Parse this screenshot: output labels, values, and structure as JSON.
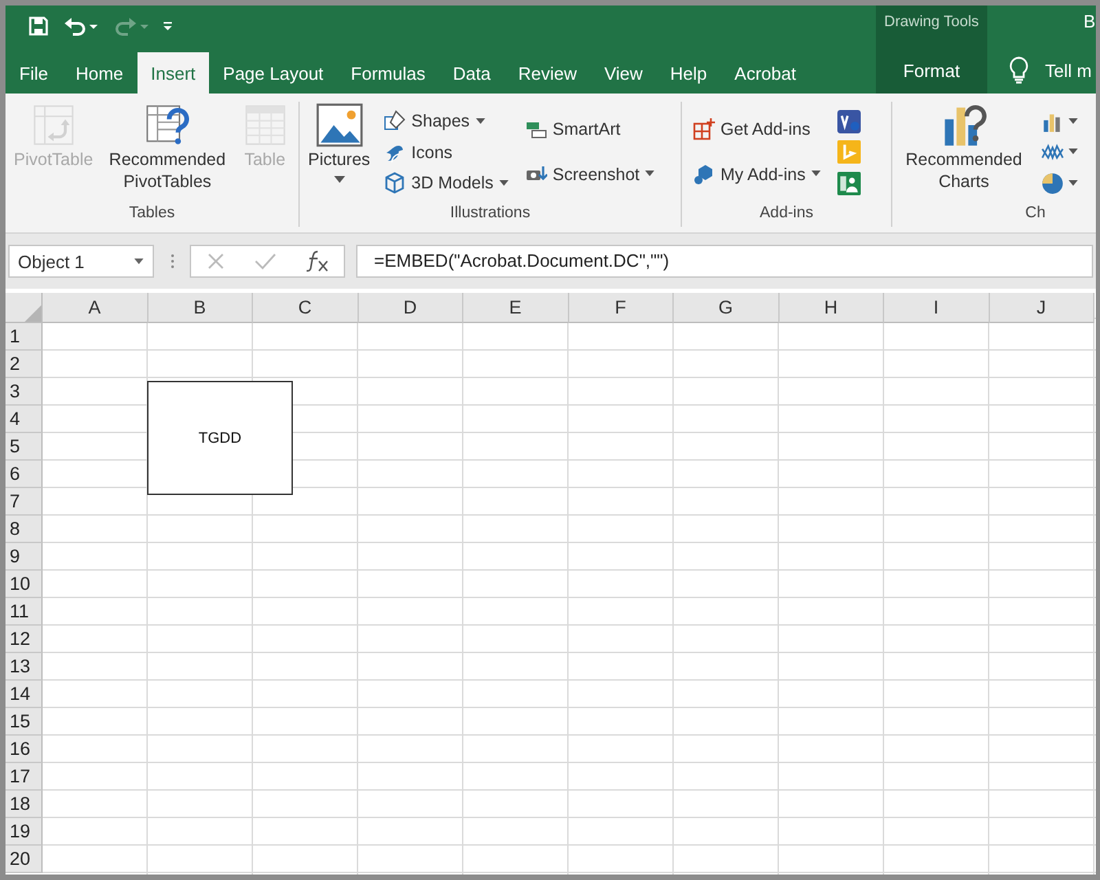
{
  "quick_access": [
    {
      "kind": "save",
      "disabled": false
    },
    {
      "kind": "undo",
      "disabled": false
    },
    {
      "kind": "redo",
      "disabled": true
    },
    {
      "kind": "customize",
      "disabled": false
    }
  ],
  "contextual": {
    "title": "Drawing Tools"
  },
  "title_cut": "B",
  "tabs": [
    {
      "label": "File",
      "selected": false,
      "contextual": false
    },
    {
      "label": "Home",
      "selected": false,
      "contextual": false
    },
    {
      "label": "Insert",
      "selected": true,
      "contextual": false
    },
    {
      "label": "Page Layout",
      "selected": false,
      "contextual": false
    },
    {
      "label": "Formulas",
      "selected": false,
      "contextual": false
    },
    {
      "label": "Data",
      "selected": false,
      "contextual": false
    },
    {
      "label": "Review",
      "selected": false,
      "contextual": false
    },
    {
      "label": "View",
      "selected": false,
      "contextual": false
    },
    {
      "label": "Help",
      "selected": false,
      "contextual": false
    },
    {
      "label": "Acrobat",
      "selected": false,
      "contextual": false
    },
    {
      "label": "Format",
      "selected": false,
      "contextual": true
    }
  ],
  "tell_me": "Tell m",
  "ribbon": [
    {
      "label": "Tables",
      "items": [
        {
          "kind": "large",
          "label": "PivotTable",
          "disabled": true,
          "dropdown": false
        },
        {
          "kind": "large",
          "label": "Recommended PivotTables",
          "disabled": false,
          "dropdown": false
        },
        {
          "kind": "large",
          "label": "Table",
          "disabled": true,
          "dropdown": false
        }
      ]
    },
    {
      "label": "Illustrations",
      "items": [
        {
          "kind": "large",
          "label": "Pictures",
          "disabled": false,
          "dropdown": true
        },
        {
          "kind": "small",
          "label": "Shapes",
          "disabled": false,
          "dropdown": true
        },
        {
          "kind": "small",
          "label": "Icons",
          "disabled": false,
          "dropdown": false
        },
        {
          "kind": "small",
          "label": "3D Models",
          "disabled": false,
          "dropdown": true
        },
        {
          "kind": "small",
          "label": "SmartArt",
          "disabled": false,
          "dropdown": false
        },
        {
          "kind": "small",
          "label": "Screenshot",
          "disabled": false,
          "dropdown": true
        }
      ]
    },
    {
      "label": "Add-ins",
      "items": [
        {
          "kind": "small",
          "label": "Get Add-ins",
          "disabled": false,
          "dropdown": false
        },
        {
          "kind": "small",
          "label": "My Add-ins",
          "disabled": false,
          "dropdown": true
        },
        {
          "kind": "icon",
          "dropdown": false
        },
        {
          "kind": "icon",
          "dropdown": false
        },
        {
          "kind": "icon",
          "dropdown": false
        }
      ]
    },
    {
      "label": "Ch",
      "items": [
        {
          "kind": "large",
          "label": "Recommended Charts",
          "disabled": false,
          "dropdown": false
        },
        {
          "kind": "icon",
          "dropdown": true
        },
        {
          "kind": "icon",
          "dropdown": true
        },
        {
          "kind": "icon",
          "dropdown": true
        }
      ]
    }
  ],
  "name_box": {
    "value": "Object 1"
  },
  "formula_bar": {
    "value": "=EMBED(\"Acrobat.Document.DC\",\"\")"
  },
  "sheet": {
    "columns": [
      "A",
      "B",
      "C",
      "D",
      "E",
      "F",
      "G",
      "H",
      "I",
      "J"
    ],
    "rows": [
      "1",
      "2",
      "3",
      "4",
      "5",
      "6",
      "7",
      "8",
      "9",
      "10",
      "11",
      "12",
      "13",
      "14",
      "15",
      "16",
      "17",
      "18",
      "19",
      "20"
    ],
    "object": {
      "text": "TGDD"
    }
  }
}
